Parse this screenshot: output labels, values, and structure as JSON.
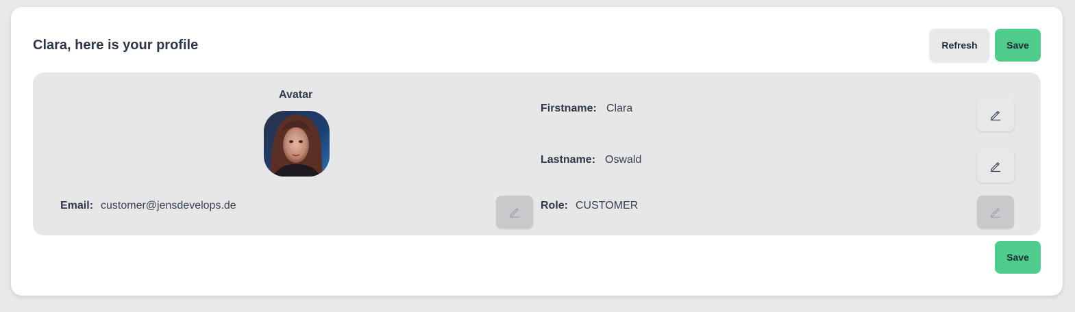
{
  "header": {
    "title": "Clara, here is your profile",
    "refresh_label": "Refresh",
    "save_label": "Save"
  },
  "profile": {
    "avatar_label": "Avatar",
    "firstname_label": "Firstname:",
    "firstname_value": "Clara",
    "lastname_label": "Lastname:",
    "lastname_value": "Oswald",
    "email_label": "Email:",
    "email_value": "customer@jensdevelops.de",
    "role_label": "Role:",
    "role_value": "CUSTOMER"
  },
  "footer": {
    "save_label": "Save"
  },
  "icons": {
    "edit": "pencil-icon"
  },
  "colors": {
    "save_button": "#4fcb8d",
    "panel_background": "#e7e7e7",
    "disabled_button": "#c9c9cc"
  }
}
